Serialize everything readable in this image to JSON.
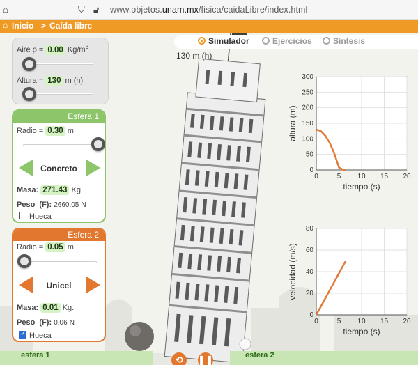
{
  "browser": {
    "url_prefix": "www.objetos.",
    "url_domain": "unam.mx",
    "url_path": "/fisica/caidaLibre/index.html"
  },
  "breadcrumb": {
    "home": "Inicio",
    "separator": ">",
    "current": "Caída libre"
  },
  "tabs": [
    {
      "label": "Simulador",
      "active": true
    },
    {
      "label": "Ejercicios",
      "active": false
    },
    {
      "label": "Síntesis",
      "active": false
    }
  ],
  "environment": {
    "air_label": "Aire ρ =",
    "air_value": "0.00",
    "air_unit": "Kg/m",
    "air_unit_sup": "3",
    "height_label": "Altura =",
    "height_value": "130",
    "height_unit": "m (h)"
  },
  "tower_height_label": "130 m (h)",
  "sphere1": {
    "title": "Esfera 1",
    "radius_label": "Radio =",
    "radius_value": "0.30",
    "radius_unit": "m",
    "material": "Concreto",
    "mass_label": "Masa:",
    "mass_value": "271.43",
    "mass_unit": "Kg.",
    "weight_label": "Peso",
    "weight_symbol": "(F):",
    "weight_value": "2660.05",
    "weight_unit": "N",
    "hollow_label": "Hueca",
    "hollow_checked": false,
    "radius_level": 1.0
  },
  "sphere2": {
    "title": "Esfera 2",
    "radius_label": "Radio =",
    "radius_value": "0.05",
    "radius_unit": "m",
    "material": "Unicel",
    "mass_label": "Masa:",
    "mass_value": "0.01",
    "mass_unit": "Kg.",
    "weight_label": "Peso",
    "weight_symbol": "(F):",
    "weight_value": "0.06",
    "weight_unit": "N",
    "hollow_label": "Hueca",
    "hollow_checked": true,
    "radius_level": 0.0
  },
  "bottom": {
    "tab1": "esfera 1",
    "tab2": "esfera 2"
  },
  "colors": {
    "orange": "#f09a26",
    "green": "#8cc56a",
    "sphere2": "#e2782f",
    "curve": "#e07a3a"
  },
  "chart_data": [
    {
      "type": "line",
      "xlabel": "tiempo (s)",
      "ylabel": "altura (m)",
      "xlim": [
        0,
        20
      ],
      "ylim": [
        0,
        300
      ],
      "xticks": [
        0,
        5,
        10,
        15,
        20
      ],
      "yticks": [
        0,
        50,
        100,
        150,
        200,
        250,
        300
      ],
      "series": [
        {
          "x": [
            0,
            1,
            2,
            3,
            4,
            5,
            6,
            6.5
          ],
          "y": [
            130,
            125,
            110,
            86,
            52,
            8,
            0,
            0
          ]
        }
      ]
    },
    {
      "type": "line",
      "xlabel": "tiempo (s)",
      "ylabel": "velocidad (m/s)",
      "xlim": [
        0,
        20
      ],
      "ylim": [
        0,
        80
      ],
      "xticks": [
        0,
        5,
        10,
        15,
        20
      ],
      "yticks": [
        0,
        20,
        40,
        60,
        80
      ],
      "series": [
        {
          "x": [
            0,
            6.5
          ],
          "y": [
            0,
            50
          ]
        }
      ]
    }
  ]
}
